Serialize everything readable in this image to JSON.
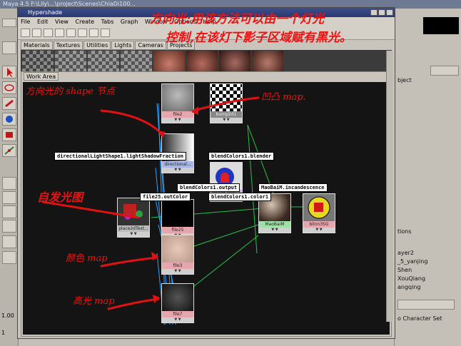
{
  "maya": {
    "title": "Maya 4.5  F:\\Lily\\...\\project\\Scenes\\ChiaDi100...",
    "right_panel": {
      "object_label": "bject",
      "layers": [
        "ayer2",
        "_5_yanjing",
        "Shen",
        "XouQiang",
        "angqing"
      ],
      "options_label": "tions",
      "character_set": "o Character Set"
    },
    "left_values": [
      "1.00",
      "1"
    ]
  },
  "hypershade": {
    "title": "Hypershade",
    "menu": [
      "File",
      "Edit",
      "View",
      "Create",
      "Tabs",
      "Graph",
      "Window",
      "Options",
      "Help"
    ],
    "tabs": [
      "Materials",
      "Textures",
      "Utilities",
      "Lights",
      "Cameras",
      "Projects"
    ],
    "work_area_tab": "Work Area",
    "nodes": {
      "file2": "file2",
      "bump2d1": "bump2d1",
      "directional": "directional...",
      "blend": "blendColors1",
      "file25": "file25",
      "place2d": "place2dText...",
      "maobaim": "MaoBaiM",
      "blinn": "blinn3SG",
      "file3": "file3",
      "file7": "file7"
    },
    "connection_labels": {
      "shadow": "directionalLightShape1.lightShadowFraction",
      "blender": "blendColors1.blender",
      "output": "blendColors1.output",
      "incandescence": "MaoBaiM.incandescence",
      "color1": "blendColors1.color1",
      "outcolor": "file25.outColor"
    }
  },
  "annotations": {
    "top_line1": "方向光:用该方法可以由一个灯光",
    "top_line2": "控制,在该灯下影子区域赋有黑光。",
    "shape_node": "方向光的 shape 节点",
    "bump_map": "凹凸 map.",
    "self_light": "自发光图",
    "color_map": "颜色 map",
    "highlight_map": "高光 map"
  },
  "colors": {
    "annotation": "#e11111",
    "graph_bg": "#141414",
    "title_bar": "#2a3870"
  }
}
